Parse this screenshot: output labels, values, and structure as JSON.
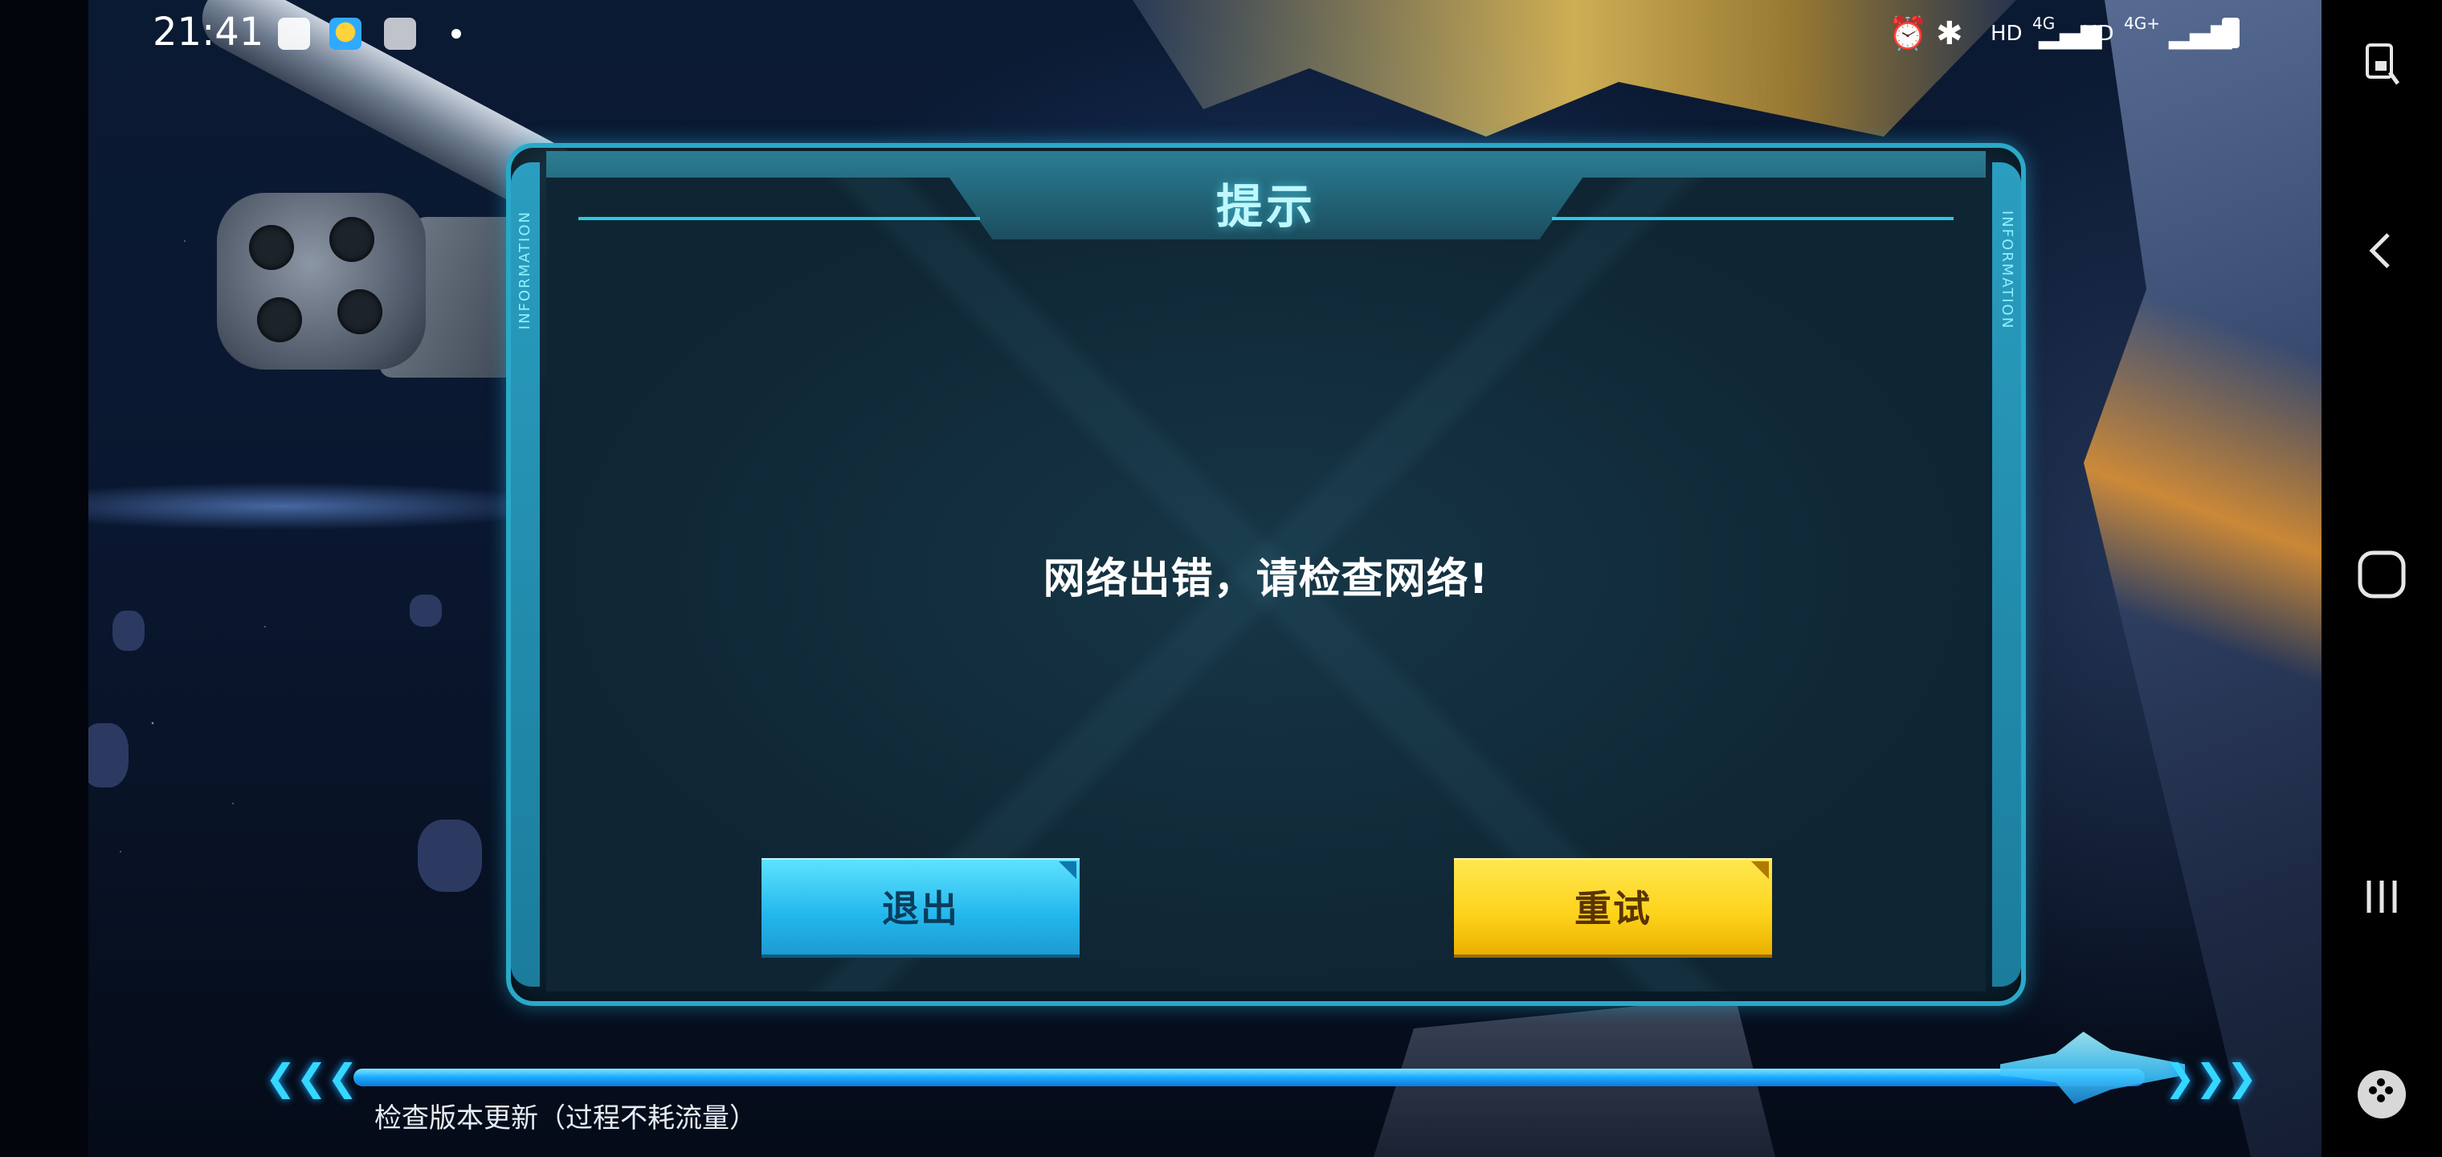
{
  "status_bar": {
    "time": "21:41",
    "left_icons": [
      "image-icon",
      "app-icon",
      "checklist-icon",
      "more-dot"
    ],
    "right_text": [
      "HD",
      "4G",
      "HD",
      "4G+"
    ],
    "right_icons": [
      "alarm-icon",
      "bluetooth-icon",
      "signal-icon",
      "signal-icon",
      "battery-icon"
    ]
  },
  "dialog": {
    "title": "提示",
    "side_label": "INFORMATION",
    "message": "网络出错，请检查网络!",
    "exit_label": "退出",
    "retry_label": "重试"
  },
  "loading": {
    "status_text": "检查版本更新（过程不耗流量）",
    "progress": 1.0
  },
  "nav_bar": {
    "buttons": [
      "screen-lock-icon",
      "back-icon",
      "home-icon",
      "recents-icon",
      "game-tools-icon"
    ]
  },
  "colors": {
    "accent_cyan": "#2aa9c9",
    "exit_button": "#22b7ec",
    "retry_button": "#fdd21a",
    "progress_fill": "#19a9ff"
  }
}
